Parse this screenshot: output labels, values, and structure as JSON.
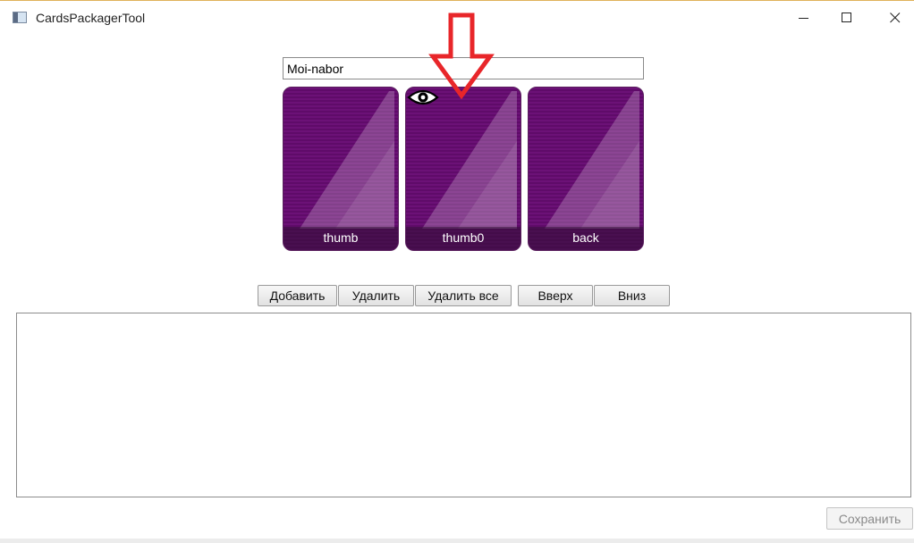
{
  "window": {
    "title": "CardsPackagerTool"
  },
  "set_name": {
    "value": "Moi-nabor"
  },
  "cards": [
    {
      "label": "thumb"
    },
    {
      "label": "thumb0"
    },
    {
      "label": "back"
    }
  ],
  "preview_icon": "eye-icon",
  "annotation": {
    "type": "red-arrow",
    "color": "#e8262a"
  },
  "toolbar": {
    "add_label": "Добавить",
    "delete_label": "Удалить",
    "delete_all_label": "Удалить все",
    "up_label": "Вверх",
    "down_label": "Вниз"
  },
  "footer": {
    "save_label": "Сохранить"
  },
  "colors": {
    "card_purple": "#6c1177",
    "arrow_red": "#e8262a"
  }
}
